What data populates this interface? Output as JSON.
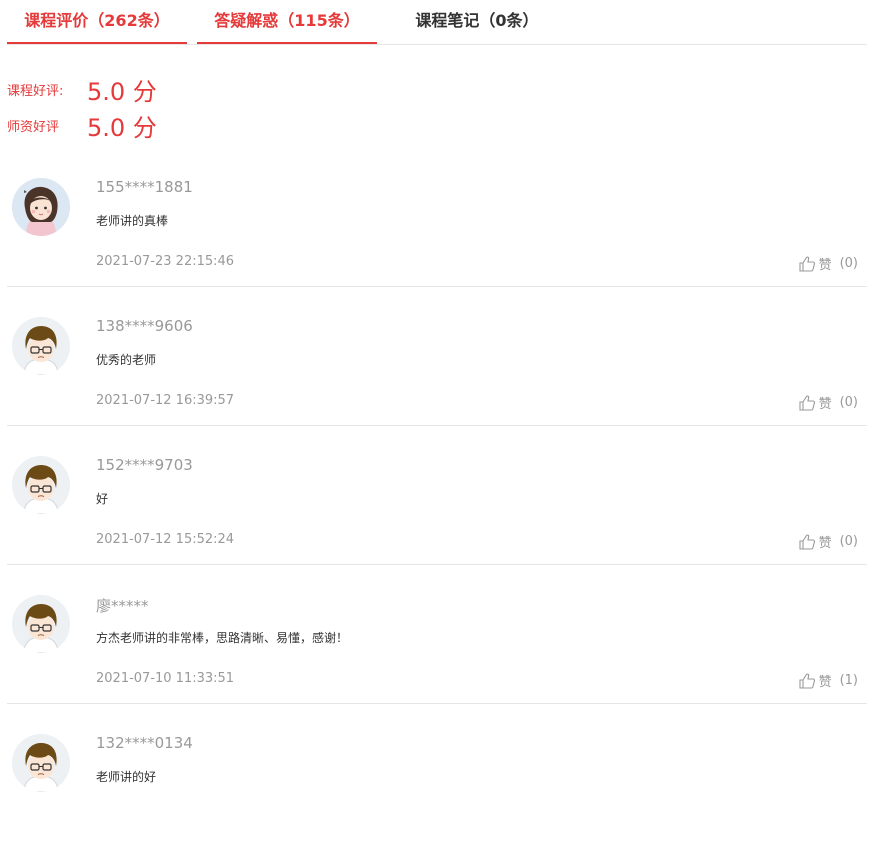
{
  "tabs": [
    {
      "label": "课程评价（262条）",
      "active": true
    },
    {
      "label": "答疑解惑（115条）",
      "active": true
    },
    {
      "label": "课程笔记（0条）",
      "active": false
    }
  ],
  "ratings": [
    {
      "label": "课程好评:",
      "value": "5.0 分"
    },
    {
      "label": "师资好评",
      "value": "5.0 分"
    }
  ],
  "reviews": [
    {
      "user": "155****1881",
      "content": "老师讲的真棒",
      "time": "2021-07-23 22:15:46",
      "like_label": "赞",
      "like_count": "(0)",
      "avatar": "girl-avatar"
    },
    {
      "user": "138****9606",
      "content": "优秀的老师",
      "time": "2021-07-12 16:39:57",
      "like_label": "赞",
      "like_count": "(0)",
      "avatar": "boy-avatar"
    },
    {
      "user": "152****9703",
      "content": "好",
      "time": "2021-07-12 15:52:24",
      "like_label": "赞",
      "like_count": "(0)",
      "avatar": "boy-avatar"
    },
    {
      "user": "廖*****",
      "content": "方杰老师讲的非常棒，思路清晰、易懂，感谢！",
      "time": "2021-07-10 11:33:51",
      "like_label": "赞",
      "like_count": "(1)",
      "avatar": "boy-avatar"
    },
    {
      "user": "132****0134",
      "content": "老师讲的好",
      "time": "",
      "like_label": "",
      "like_count": "",
      "avatar": "boy-avatar"
    }
  ],
  "colors": {
    "accent": "#e5393a",
    "muted": "#999999",
    "text": "#333333",
    "divider": "#e6e6e6"
  }
}
